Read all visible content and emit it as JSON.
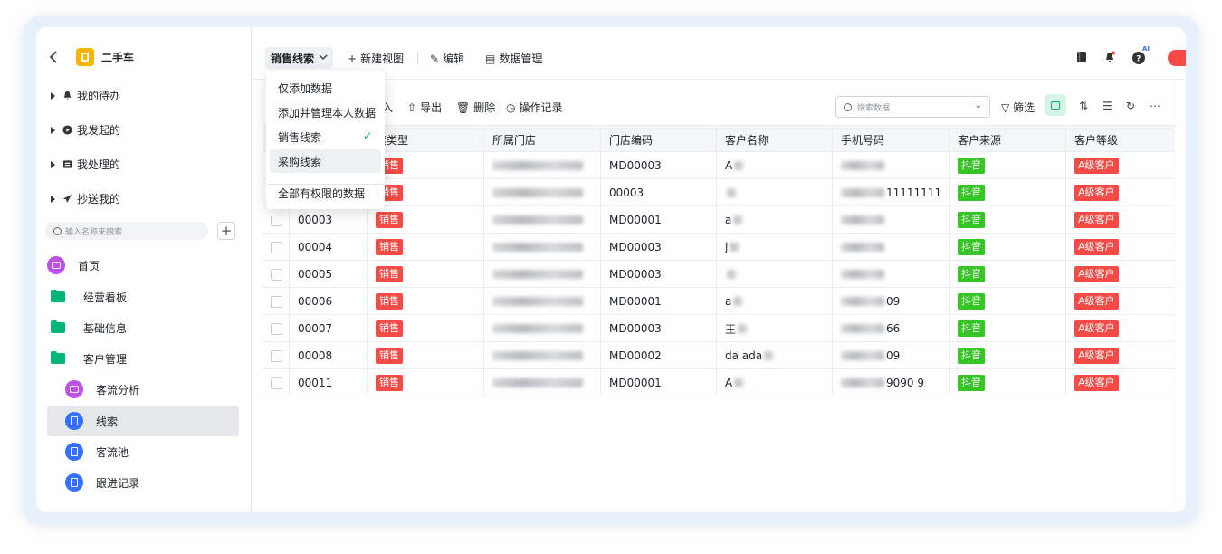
{
  "app": {
    "title": "二手车"
  },
  "sidebar": {
    "groups": [
      {
        "label": "我的待办",
        "icon": "bell-icon"
      },
      {
        "label": "我发起的",
        "icon": "play-icon"
      },
      {
        "label": "我处理的",
        "icon": "inbox-icon"
      },
      {
        "label": "抄送我的",
        "icon": "send-icon"
      }
    ],
    "search_placeholder": "输入名称来搜索",
    "items": [
      {
        "label": "首页",
        "icon": "home-icon"
      },
      {
        "label": "经营看板",
        "icon": "folder-icon"
      },
      {
        "label": "基础信息",
        "icon": "folder-icon"
      },
      {
        "label": "客户管理",
        "icon": "folder-icon"
      },
      {
        "label": "客流分析",
        "icon": "chart-icon"
      },
      {
        "label": "线索",
        "icon": "doc-icon"
      },
      {
        "label": "客流池",
        "icon": "doc-icon"
      },
      {
        "label": "跟进记录",
        "icon": "doc-icon"
      }
    ],
    "active_item": "线索"
  },
  "topbar": {
    "view_label": "销售线索",
    "new_view": "新建视图",
    "edit": "编辑",
    "data_manage": "数据管理",
    "ai_badge": "AI"
  },
  "dropdown": {
    "items": [
      "仅添加数据",
      "添加并管理本人数据",
      "销售线索",
      "采购线索",
      "全部有权限的数据"
    ],
    "selected": "销售线索"
  },
  "toolbar": {
    "import_partial": "入",
    "export": "导出",
    "delete": "删除",
    "history": "操作记录",
    "search_placeholder": "搜索数据",
    "filter": "筛选"
  },
  "table": {
    "headers": [
      "",
      "",
      "索类型",
      "所属门店",
      "门店编码",
      "客户名称",
      "手机号码",
      "客户来源",
      "客户等级"
    ],
    "rows": [
      {
        "id": "",
        "type": "销售",
        "store": "",
        "code": "MD00003",
        "customer": "A",
        "phone": "",
        "source": "抖音",
        "level": "A级客户"
      },
      {
        "id": "",
        "type": "销售",
        "store": "",
        "code": "00003",
        "customer": "",
        "phone": "11111111",
        "source": "抖音",
        "level": "A级客户"
      },
      {
        "id": "00003",
        "type": "销售",
        "store": "",
        "code": "MD00001",
        "customer": "a",
        "phone": "",
        "source": "抖音",
        "level": "A级客户"
      },
      {
        "id": "00004",
        "type": "销售",
        "store": "",
        "code": "MD00003",
        "customer": "j",
        "phone": "",
        "source": "抖音",
        "level": "A级客户"
      },
      {
        "id": "00005",
        "type": "销售",
        "store": "",
        "code": "MD00003",
        "customer": "",
        "phone": "",
        "source": "抖音",
        "level": "A级客户"
      },
      {
        "id": "00006",
        "type": "销售",
        "store": "",
        "code": "MD00001",
        "customer": "a",
        "phone": "09",
        "source": "抖音",
        "level": "A级客户"
      },
      {
        "id": "00007",
        "type": "销售",
        "store": "",
        "code": "MD00003",
        "customer": "王",
        "phone": "66",
        "source": "抖音",
        "level": "A级客户"
      },
      {
        "id": "00008",
        "type": "销售",
        "store": "",
        "code": "MD00002",
        "customer": "da ada",
        "phone": "09",
        "source": "抖音",
        "level": "A级客户"
      },
      {
        "id": "00011",
        "type": "销售",
        "store": "",
        "code": "MD00001",
        "customer": "A",
        "phone": "9090 9",
        "source": "抖音",
        "level": "A级客户"
      }
    ]
  },
  "colors": {
    "accent_green": "#00b578",
    "tag_red": "#f54a45",
    "tag_green": "#34c724",
    "logo_yellow": "#f7b500",
    "purple": "#c04ee8",
    "blue": "#3370ff"
  }
}
